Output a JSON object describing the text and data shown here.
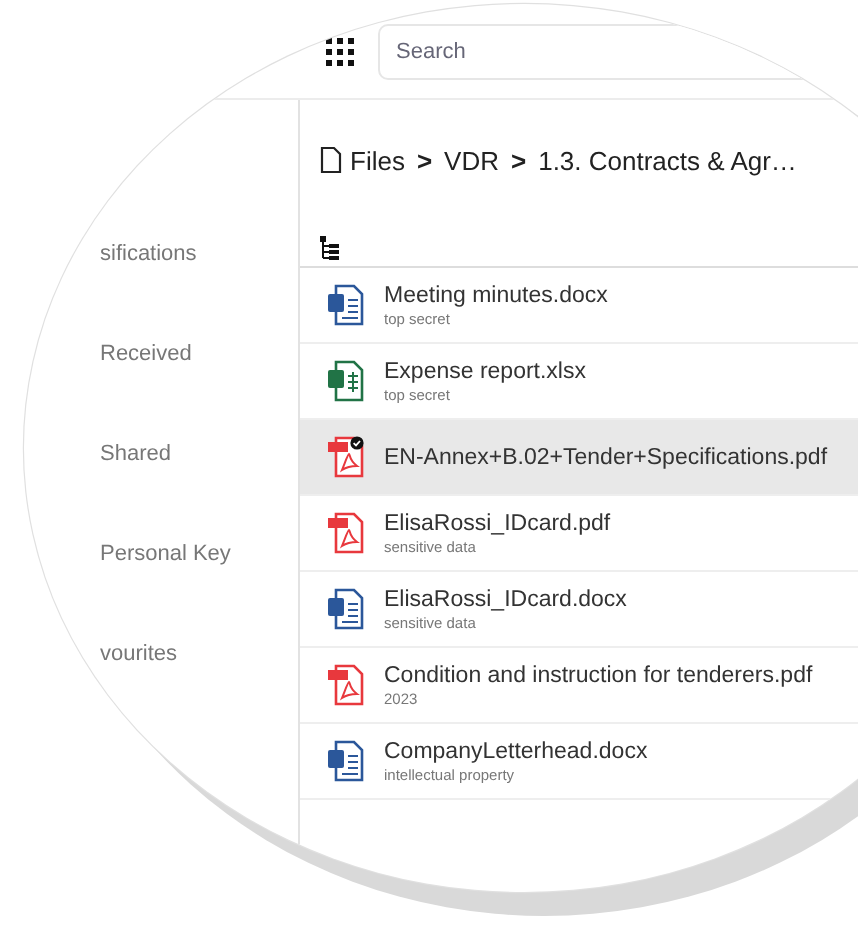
{
  "search": {
    "placeholder": "Search"
  },
  "sidebar": {
    "items": [
      {
        "label": "sifications"
      },
      {
        "label": "Received"
      },
      {
        "label": "Shared"
      },
      {
        "label": "Personal Key"
      },
      {
        "label": "vourites"
      }
    ]
  },
  "breadcrumb": [
    "Files",
    ">",
    "VDR",
    ">",
    "1.3. Contracts & Agr…"
  ],
  "files": [
    {
      "name": "Meeting minutes.docx",
      "tag": "top secret",
      "kind": "word",
      "selected": false,
      "badge": false
    },
    {
      "name": "Expense report.xlsx",
      "tag": "top secret",
      "kind": "excel",
      "selected": false,
      "badge": false
    },
    {
      "name": "EN-Annex+B.02+Tender+Specifications.pdf",
      "kind": "pdf",
      "selected": true,
      "badge": true
    },
    {
      "name": "ElisaRossi_IDcard.pdf",
      "tag": "sensitive data",
      "kind": "pdf",
      "selected": false,
      "badge": false
    },
    {
      "name": "ElisaRossi_IDcard.docx",
      "tag": "sensitive data",
      "kind": "word",
      "selected": false,
      "badge": false
    },
    {
      "name": "Condition and instruction for tenderers.pdf",
      "tag": "2023",
      "kind": "pdf",
      "selected": false,
      "badge": false
    },
    {
      "name": "CompanyLetterhead.docx",
      "tag": "intellectual property",
      "kind": "word",
      "selected": false,
      "badge": false
    }
  ]
}
